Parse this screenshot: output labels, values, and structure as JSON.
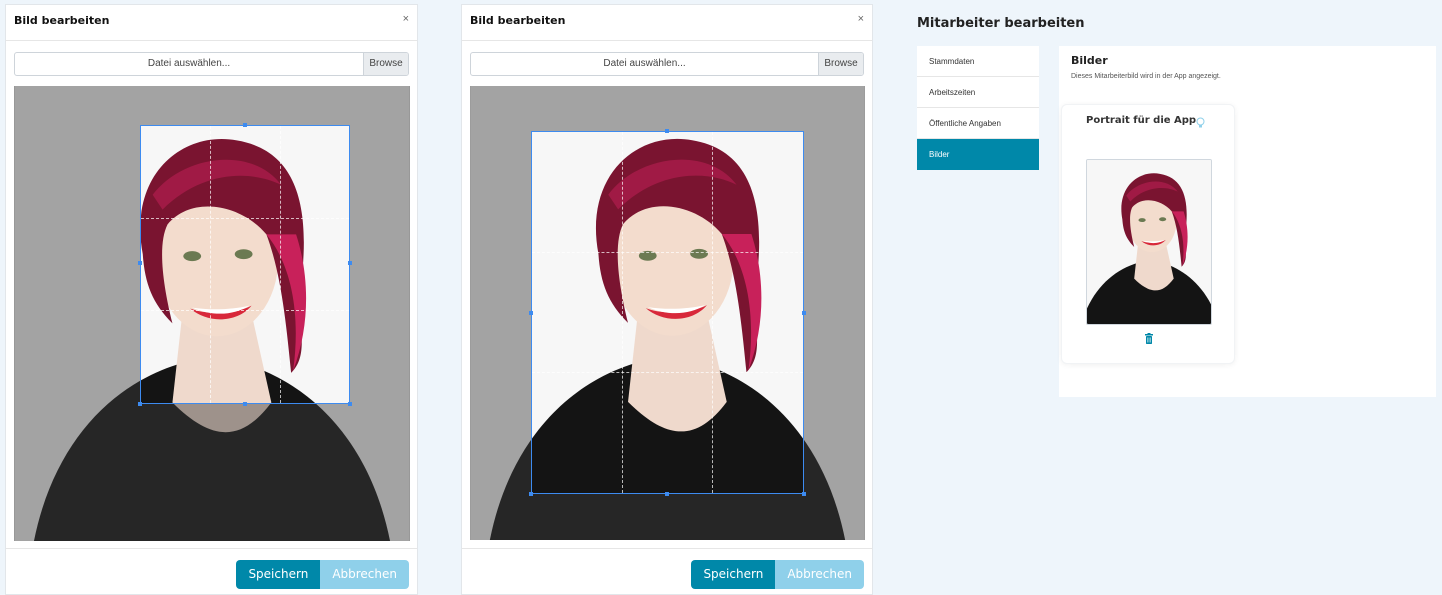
{
  "modal1": {
    "title": "Bild bearbeiten",
    "close": "×",
    "file_label": "Datei auswählen...",
    "browse": "Browse",
    "save": "Speichern",
    "cancel": "Abbrechen"
  },
  "modal2": {
    "title": "Bild bearbeiten",
    "close": "×",
    "file_label": "Datei auswählen...",
    "browse": "Browse",
    "save": "Speichern",
    "cancel": "Abbrechen"
  },
  "page": {
    "title": "Mitarbeiter bearbeiten"
  },
  "nav": {
    "items": [
      {
        "label": "Stammdaten"
      },
      {
        "label": "Arbeitszeiten"
      },
      {
        "label": "Öffentliche Angaben"
      },
      {
        "label": "Bilder"
      }
    ],
    "active_index": 3
  },
  "content": {
    "title": "Bilder",
    "subtitle": "Dieses Mitarbeiterbild wird in der App angezeigt.",
    "portrait_label": "Portrait für die App",
    "icons": [
      "lightbulb-icon",
      "trash-icon",
      "close-icon"
    ]
  },
  "colors": {
    "accent": "#0088a9",
    "accent_light": "#8fd0ea",
    "crop_border": "#3d8bf0",
    "background": "#eef5fb"
  }
}
